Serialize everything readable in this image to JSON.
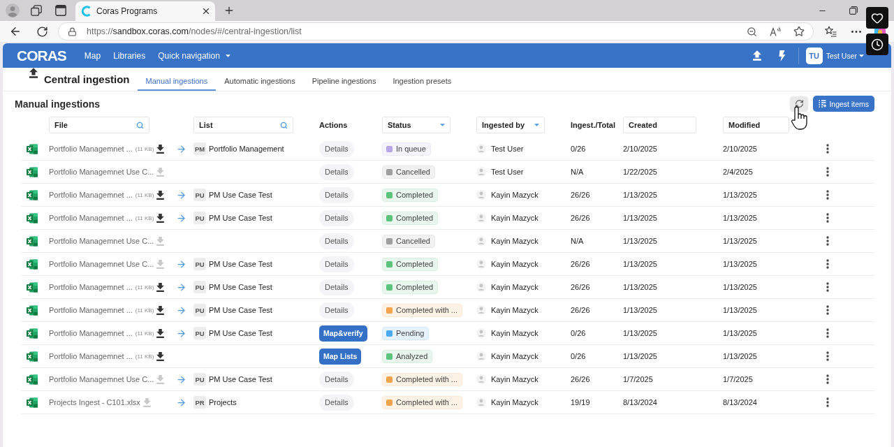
{
  "browser": {
    "tab_title": "Coras Programs",
    "url": {
      "scheme": "https://",
      "host": "sandbox.coras.com",
      "path": "/nodes/#/central-ingestion/list"
    }
  },
  "app_header": {
    "logo": "CORAS",
    "nav": [
      {
        "label": "Map",
        "kind": "link"
      },
      {
        "label": "Libraries",
        "kind": "link"
      },
      {
        "label": "Quick navigation",
        "kind": "dropdown"
      }
    ],
    "user": {
      "initials": "TU",
      "name": "Test User"
    }
  },
  "page": {
    "title": "Central ingestion",
    "tabs": [
      {
        "label": "Manual ingestions",
        "selected": true
      },
      {
        "label": "Automatic ingestions",
        "selected": false
      },
      {
        "label": "Pipeline ingestions",
        "selected": false
      },
      {
        "label": "Ingestion presets",
        "selected": false
      }
    ]
  },
  "section": {
    "title": "Manual ingestions",
    "primary_button": "Ingest items"
  },
  "table": {
    "columns": [
      {
        "label": "File",
        "kind": "search"
      },
      {
        "label": "List",
        "kind": "search"
      },
      {
        "label": "Actions",
        "kind": "plain"
      },
      {
        "label": "Status",
        "kind": "dropdown"
      },
      {
        "label": "Ingested by",
        "kind": "dropdown"
      },
      {
        "label": "Ingest./Total",
        "kind": "plain"
      },
      {
        "label": "Created",
        "kind": "box"
      },
      {
        "label": "Modified",
        "kind": "box"
      }
    ],
    "rows": [
      {
        "file": "Portfolio Managemnet ...",
        "size": "(11 KB)",
        "download_enabled": true,
        "list": {
          "badge": "PM",
          "name": "Portfolio Management"
        },
        "action": {
          "label": "Details",
          "kind": "secondary"
        },
        "status": {
          "label": "In queue",
          "color": "#b7a6ea"
        },
        "ingested_by": "Test User",
        "ingested_total": "0/26",
        "created": "2/10/2025",
        "modified": "2/10/2025"
      },
      {
        "file": "Portfolio Managemnet Use C...",
        "download_enabled": false,
        "action": {
          "label": "Details",
          "kind": "secondary"
        },
        "status": {
          "label": "Cancelled",
          "color": "#9e9e9e"
        },
        "ingested_by": "Test User",
        "ingested_total": "N/A",
        "created": "1/22/2025",
        "modified": "2/4/2025"
      },
      {
        "file": "Portfolio Managemnet ...",
        "size": "(11 KB)",
        "download_enabled": true,
        "list": {
          "badge": "PU",
          "name": "PM Use Case Test"
        },
        "action": {
          "label": "Details",
          "kind": "secondary"
        },
        "status": {
          "label": "Completed",
          "color": "#5cc27c"
        },
        "ingested_by": "Kayin Mazyck",
        "ingested_total": "26/26",
        "created": "1/13/2025",
        "modified": "1/13/2025"
      },
      {
        "file": "Portfolio Managemnet ...",
        "size": "(11 KB)",
        "download_enabled": true,
        "list": {
          "badge": "PU",
          "name": "PM Use Case Test"
        },
        "action": {
          "label": "Details",
          "kind": "secondary"
        },
        "status": {
          "label": "Completed",
          "color": "#5cc27c"
        },
        "ingested_by": "Kayin Mazyck",
        "ingested_total": "26/26",
        "created": "1/13/2025",
        "modified": "1/13/2025"
      },
      {
        "file": "Portfolio Managemnet Use C...",
        "download_enabled": false,
        "action": {
          "label": "Details",
          "kind": "secondary"
        },
        "status": {
          "label": "Cancelled",
          "color": "#9e9e9e"
        },
        "ingested_by": "Kayin Mazyck",
        "ingested_total": "N/A",
        "created": "1/13/2025",
        "modified": "1/13/2025"
      },
      {
        "file": "Portfolio Managemnet Use C...",
        "download_enabled": false,
        "list": {
          "badge": "PU",
          "name": "PM Use Case Test"
        },
        "action": {
          "label": "Details",
          "kind": "secondary"
        },
        "status": {
          "label": "Completed",
          "color": "#5cc27c"
        },
        "ingested_by": "Kayin Mazyck",
        "ingested_total": "26/26",
        "created": "1/13/2025",
        "modified": "1/13/2025"
      },
      {
        "file": "Portfolio Managemnet ...",
        "size": "(11 KB)",
        "download_enabled": true,
        "list": {
          "badge": "PU",
          "name": "PM Use Case Test"
        },
        "action": {
          "label": "Details",
          "kind": "secondary"
        },
        "status": {
          "label": "Completed",
          "color": "#5cc27c"
        },
        "ingested_by": "Kayin Mazyck",
        "ingested_total": "26/26",
        "created": "1/13/2025",
        "modified": "1/13/2025"
      },
      {
        "file": "Portfolio Managemnet ...",
        "size": "(11 KB)",
        "download_enabled": true,
        "list": {
          "badge": "PU",
          "name": "PM Use Case Test"
        },
        "action": {
          "label": "Details",
          "kind": "secondary"
        },
        "status": {
          "label": "Completed with ...",
          "color": "#f3a44c"
        },
        "ingested_by": "Kayin Mazyck",
        "ingested_total": "26/26",
        "created": "1/13/2025",
        "modified": "1/13/2025"
      },
      {
        "file": "Portfolio Managemnet ...",
        "size": "(11 KB)",
        "download_enabled": true,
        "list": {
          "badge": "PU",
          "name": "PM Use Case Test"
        },
        "action": {
          "label": "Map&verify",
          "kind": "primary"
        },
        "status": {
          "label": "Pending",
          "color": "#4aa8f5"
        },
        "ingested_by": "Kayin Mazyck",
        "ingested_total": "0/26",
        "created": "1/13/2025",
        "modified": "1/13/2025"
      },
      {
        "file": "Portfolio Managemnet ...",
        "size": "(11 KB)",
        "download_enabled": true,
        "action": {
          "label": "Map Lists",
          "kind": "primary"
        },
        "status": {
          "label": "Analyzed",
          "color": "#5cc27c"
        },
        "ingested_by": "Kayin Mazyck",
        "ingested_total": "0/26",
        "created": "1/13/2025",
        "modified": "1/13/2025"
      },
      {
        "file": "Portfolio Managemnet Use C...",
        "download_enabled": false,
        "list": {
          "badge": "PU",
          "name": "PM Use Case Test"
        },
        "action": {
          "label": "Details",
          "kind": "secondary"
        },
        "status": {
          "label": "Completed with ...",
          "color": "#f3a44c"
        },
        "ingested_by": "Kayin Mazyck",
        "ingested_total": "26/26",
        "created": "1/7/2025",
        "modified": "1/7/2025"
      },
      {
        "file": "Projects Ingest - C101.xlsx",
        "download_enabled": false,
        "list": {
          "badge": "PR",
          "name": "Projects"
        },
        "action": {
          "label": "Details",
          "kind": "secondary"
        },
        "status": {
          "label": "Completed with ...",
          "color": "#f3a44c"
        },
        "ingested_by": "Kayin Mazyck",
        "ingested_total": "19/19",
        "created": "8/13/2024",
        "modified": "8/13/2024"
      }
    ]
  }
}
